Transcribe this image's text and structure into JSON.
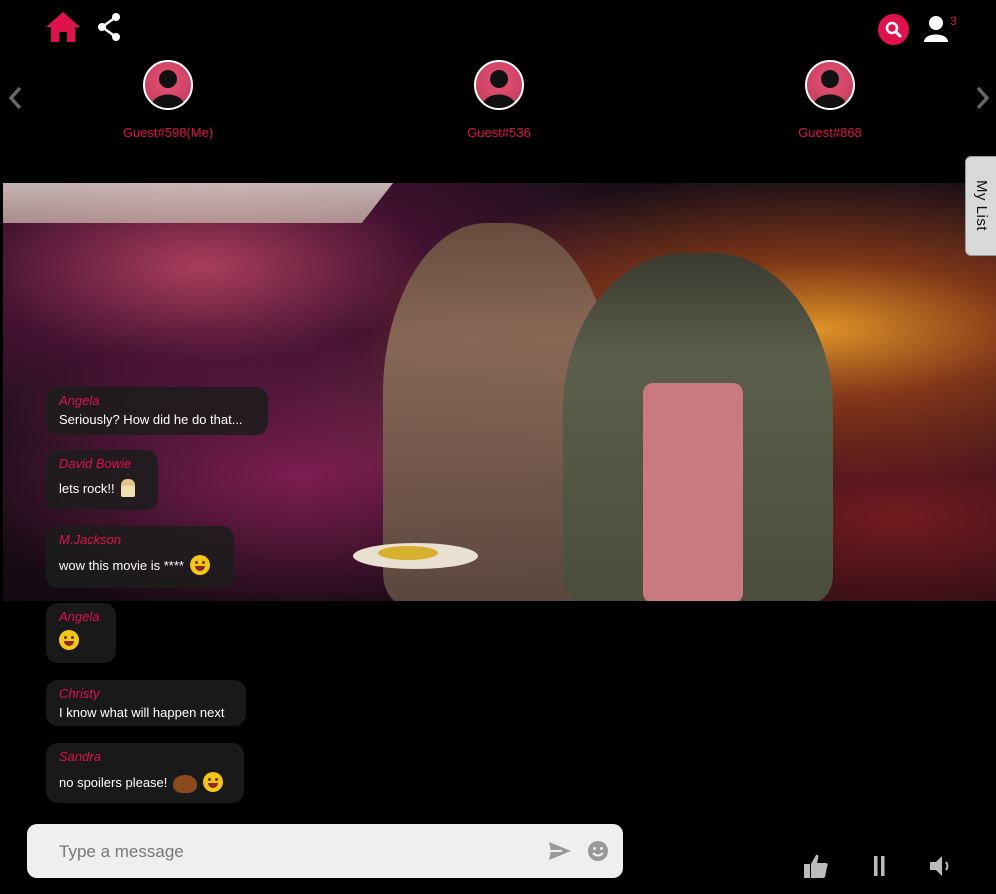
{
  "topbar": {
    "home_icon": "home-icon",
    "share_icon": "share-icon",
    "search_icon": "search-icon",
    "user_icon": "user-icon",
    "user_count": "3",
    "accent_color": "#e0124d"
  },
  "guests": [
    {
      "name": "Guest#598(Me)"
    },
    {
      "name": "Guest#536"
    },
    {
      "name": "Guest#868"
    }
  ],
  "mylist": {
    "label": "My List"
  },
  "chat": {
    "messages": [
      {
        "author": "Angela",
        "text": "Seriously? How did he do that..."
      },
      {
        "author": "David Bowie",
        "text": "lets rock!!"
      },
      {
        "author": "M.Jackson",
        "text": "wow this movie is ****"
      },
      {
        "author": "Angela",
        "text": ""
      },
      {
        "author": "Christy",
        "text": "I know what will happen next"
      },
      {
        "author": "Sandra",
        "text": "no spoilers please!"
      }
    ]
  },
  "composer": {
    "placeholder": "Type a message",
    "send_icon": "send-icon",
    "emoji_icon": "smile-icon"
  },
  "controls": {
    "like_icon": "thumbs-up-icon",
    "pause_icon": "pause-icon",
    "volume_icon": "volume-icon"
  }
}
